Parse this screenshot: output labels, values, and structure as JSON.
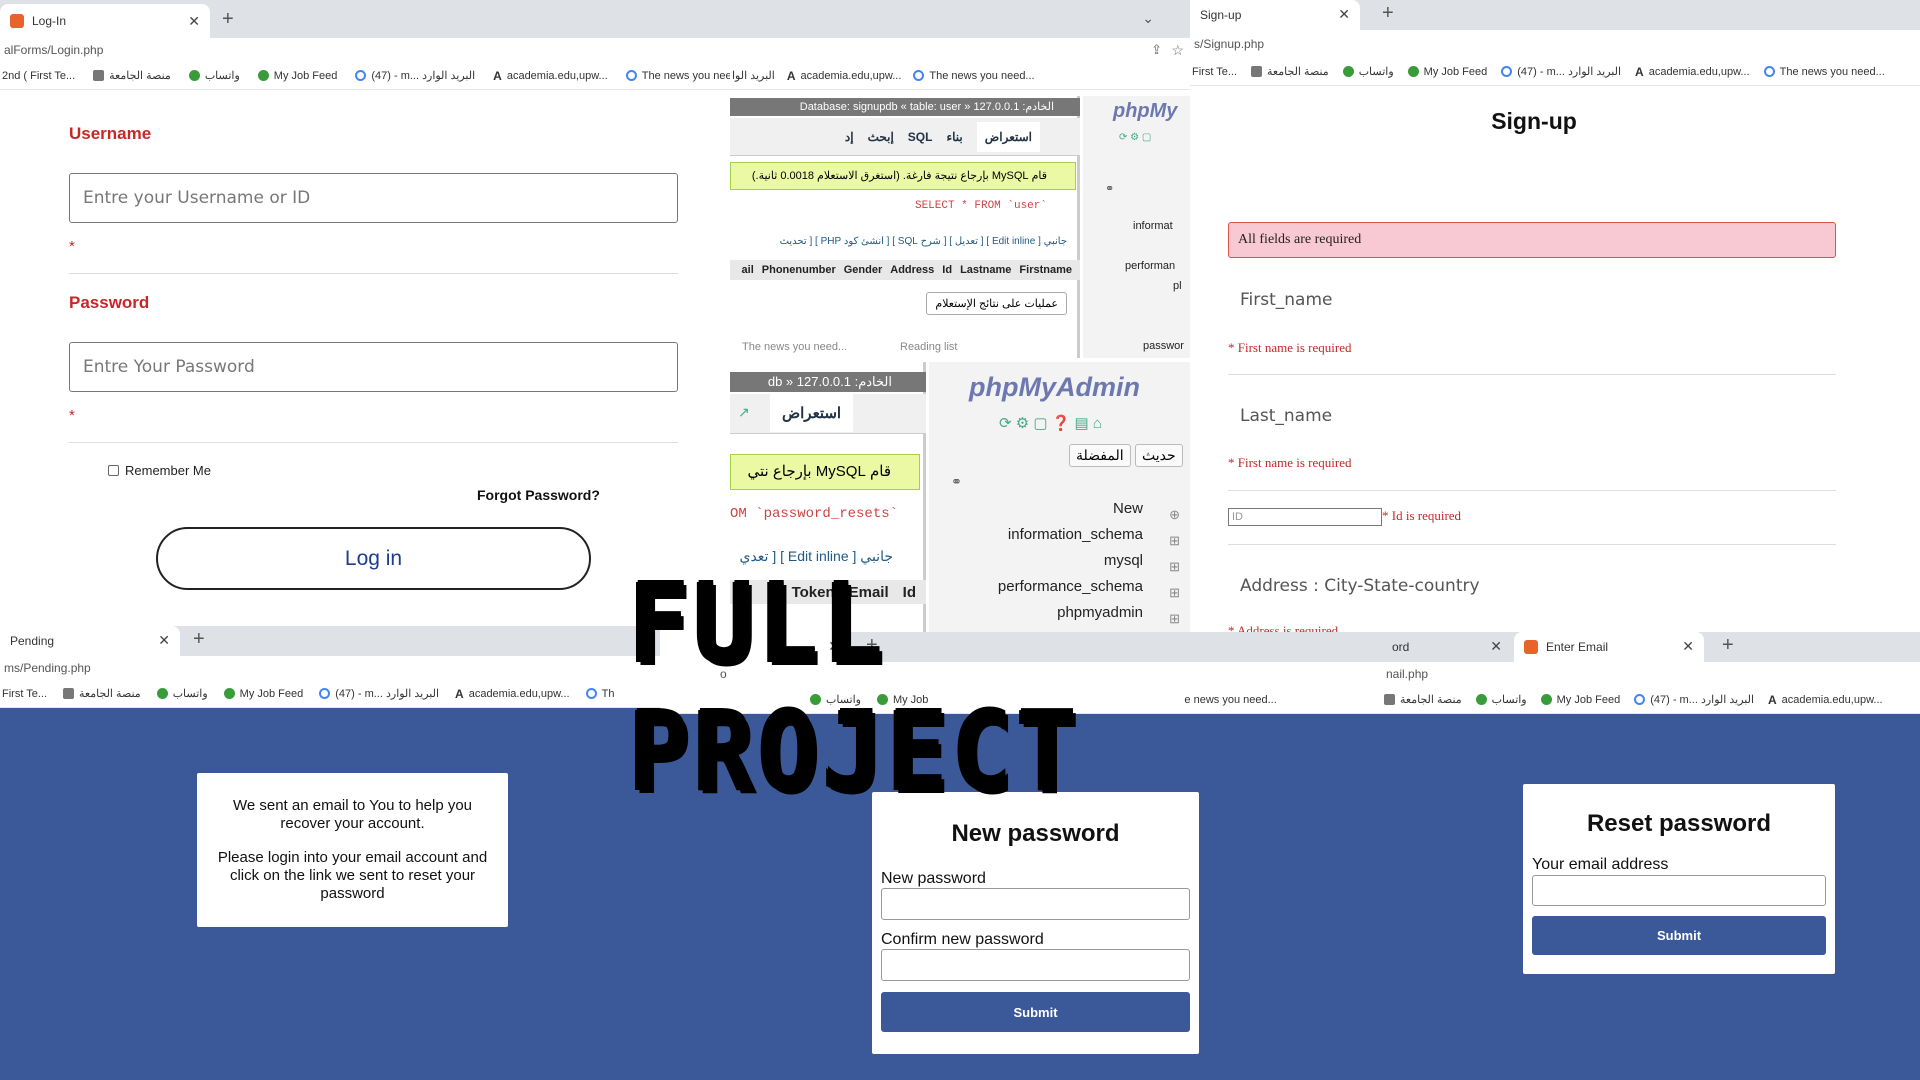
{
  "login": {
    "tab_title": "Log-In",
    "url": "alForms/Login.php",
    "bookmarks": [
      "2nd ( First Te...",
      "منصة الجامعة",
      "واتساب",
      "My Job Feed",
      "(47) - m... البريد الوارد",
      "academia.edu,upw...",
      "The news you need..."
    ],
    "username_label": "Username",
    "username_placeholder": "Entre your Username or ID",
    "required_mark": "*",
    "password_label": "Password",
    "password_placeholder": "Entre Your Password",
    "remember_label": "Remember Me",
    "forgot_label": "Forgot Password?",
    "login_button": "Log in"
  },
  "pma_top": {
    "breadcrumb": "الخادم: 127.0.0.1 « Database: signupdb « table: user",
    "tabs": [
      "استعراض",
      "بناء",
      "SQL",
      "إبحث",
      "إد"
    ],
    "success_msg": "قام MySQL بإرجاع نتيجة فارغة. (استغرق الاستعلام 0.0018 ثانية.)",
    "query": "SELECT * FROM `user`",
    "options_line": "جانبي [ Edit inline ] [ تعديل ] [ شرح SQL ] [ أنشئ كود PHP ] [ تحديث",
    "columns": [
      "Firstname",
      "Lastname",
      "Id",
      "Address",
      "Gender",
      "Phonenumber",
      "ail"
    ],
    "ops_button": "عمليات على نتائج الإستعلام",
    "logo": "phpMy",
    "nav_items": [
      "informat",
      "performan",
      "pl",
      "passwor"
    ],
    "bottom_frag": "The news you need...",
    "bottom_frag2": "Reading list",
    "bookmarks": [
      "البريد الوا",
      "academia.edu,upw...",
      "The news you need..."
    ]
  },
  "pma_bottom": {
    "breadcrumb": "الخادم: 127.0.0.1 « db",
    "tab_label": "استعراض",
    "success_msg": "قام MySQL بإرجاع نتي",
    "query": "OM `password_resets`",
    "options_line": "جانبي [ Edit inline ] [ تعدي",
    "columns": [
      "Id",
      "Email",
      "Token"
    ],
    "logo": "phpMyAdmin",
    "nav_buttons": [
      "حديث",
      "المفضلة"
    ],
    "tree": [
      "New",
      "information_schema",
      "mysql",
      "performance_schema",
      "phpmyadmin"
    ]
  },
  "signup": {
    "tab_title": "Sign-up",
    "url": "s/Signup.php",
    "bookmarks": [
      "First Te...",
      "منصة الجامعة",
      "واتساب",
      "My Job Feed",
      "(47) - m... البريد الوارد",
      "academia.edu,upw...",
      "The news you need..."
    ],
    "heading": "Sign-up",
    "alert": "All fields are required",
    "first_name": "First_name",
    "first_error": "* First name is required",
    "last_name": "Last_name",
    "last_error": "* First name is required",
    "id_placeholder": "ID",
    "id_error": "* Id is required",
    "address": "Address : City-State-country",
    "address_error": "* Address is required"
  },
  "pending": {
    "tab_title": "Pending",
    "url": "ms/Pending.php",
    "bookmarks": [
      "First Te...",
      "منصة الجامعة",
      "واتساب",
      "My Job Feed",
      "(47) - m... البريد الوارد",
      "academia.edu,upw...",
      "Th"
    ],
    "msg1": "We sent an email to You to help you recover your account.",
    "msg2": "Please login into your email account and click on the link we sent to reset your password"
  },
  "newpass": {
    "heading": "New password",
    "new_label": "New password",
    "confirm_label": "Confirm new password",
    "submit": "Submit",
    "bookmarks": [
      "واتساب",
      "My Job",
      "e news you need..."
    ],
    "frag": "o"
  },
  "reset": {
    "tab1": "ord",
    "tab2": "Enter Email",
    "url": "nail.php",
    "bookmarks": [
      "منصة الجامعة",
      "واتساب",
      "My Job Feed",
      "(47) - m... البريد الوارد",
      "academia.edu,upw..."
    ],
    "heading": "Reset password",
    "email_label": "Your email address",
    "submit": "Submit"
  },
  "banner": "FULL PROJECT"
}
